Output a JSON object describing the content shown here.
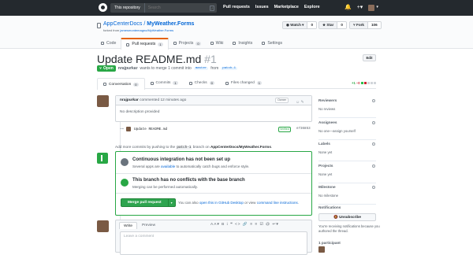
{
  "topbar": {
    "search_scope": "This repository",
    "search_placeholder": "Search",
    "nav": [
      "Pull requests",
      "Issues",
      "Marketplace",
      "Explore"
    ],
    "bell": "🔔",
    "plus": "+▾",
    "avatar_caret": "▾"
  },
  "repo": {
    "owner": "AppCenterDocs",
    "sep": " / ",
    "name": "MyWeather.Forms",
    "forked_prefix": "forked from ",
    "forked_from": "jamesmontemagno/MyWeather.Forms",
    "watch_label": "◉ Watch ▾",
    "watch_count": "0",
    "star_label": "★ Star",
    "star_count": "0",
    "fork_label": "⑂ Fork",
    "fork_count": "106",
    "tabs": [
      {
        "label": "Code",
        "count": ""
      },
      {
        "label": "Pull requests",
        "count": "1"
      },
      {
        "label": "Projects",
        "count": "0"
      },
      {
        "label": "Wiki",
        "count": ""
      },
      {
        "label": "Insights",
        "count": ""
      },
      {
        "label": "Settings",
        "count": ""
      }
    ]
  },
  "pr": {
    "title": "Update README.md",
    "number": "#1",
    "edit_label": "Edit",
    "state": "Open",
    "author": "nrajpurkar",
    "merge_text": "wants to merge 1 commit into",
    "base": "master",
    "from_text": "from",
    "head": "patch-1",
    "tabs": [
      {
        "label": "Conversation",
        "count": "0"
      },
      {
        "label": "Commits",
        "count": "1"
      },
      {
        "label": "Checks",
        "count": "0"
      },
      {
        "label": "Files changed",
        "count": "1"
      }
    ],
    "additions": "+1",
    "deletions": "−0",
    "diff_colors": [
      "#2cbe4e",
      "#cb2431",
      "#d1d5da",
      "#d1d5da",
      "#d1d5da"
    ]
  },
  "comment": {
    "author": "nrajpurkar",
    "time": "commented 12 minutes ago",
    "badge": "Owner",
    "icons": "☺ ✎",
    "body": "No description provided"
  },
  "commit": {
    "message": "Update README.md",
    "verified": "Verified",
    "sha": "e736853"
  },
  "hint": {
    "pre": "Add more commits by pushing to the",
    "branch": "patch-1",
    "mid": "branch on",
    "repo": "AppCenterDocs/MyWeather.Forms",
    "end": "."
  },
  "merge": {
    "ci_title": "Continuous integration has not been set up",
    "ci_pre": "Several apps are",
    "ci_link": "available",
    "ci_post": "to automatically catch bugs and enforce style.",
    "conflict_title": "This branch has no conflicts with the base branch",
    "conflict_sub": "Merging can be performed automatically.",
    "button": "Merge pull request",
    "button_caret": "▾",
    "also_pre": "You can also",
    "also_link1": "open this in GitHub Desktop",
    "also_mid": "or view",
    "also_link2": "command line instructions",
    "also_end": "."
  },
  "write": {
    "tab_write": "Write",
    "tab_preview": "Preview",
    "tools": "AA▾ B i ❝ <> 🔗  ≡ ≡ ☑  @ ↩▾",
    "placeholder": "Leave a comment"
  },
  "sidebar": {
    "sections": [
      {
        "header": "Reviewers",
        "value": "No reviews"
      },
      {
        "header": "Assignees",
        "value": "No one—assign yourself"
      },
      {
        "header": "Labels",
        "value": "None yet"
      },
      {
        "header": "Projects",
        "value": "None yet"
      },
      {
        "header": "Milestone",
        "value": "No milestone"
      }
    ],
    "notifications_header": "Notifications",
    "unsubscribe": "🔕 Unsubscribe",
    "notif_text": "You're receiving notifications because you authored the thread.",
    "participants": "1 participant"
  },
  "colors": {
    "green": "#28a745",
    "blue": "#0366d6",
    "orange_tab": "#e36209"
  }
}
